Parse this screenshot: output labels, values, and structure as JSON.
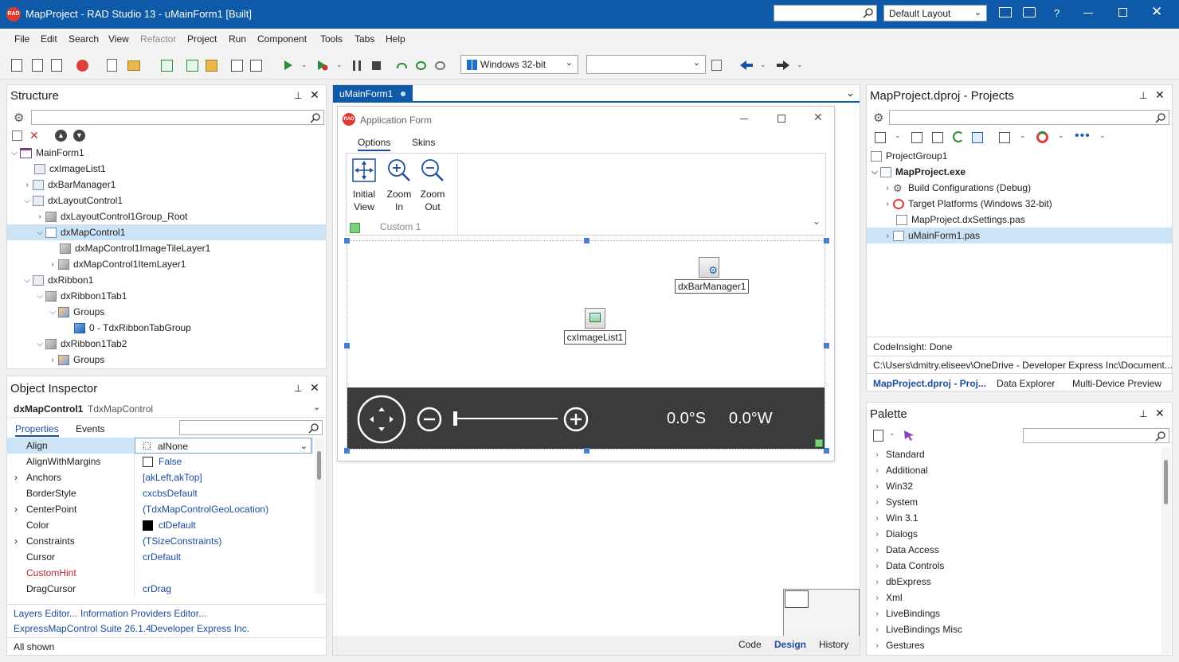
{
  "titlebar": {
    "title": "MapProject - RAD Studio 13 - uMainForm1 [Built]",
    "layout": "Default Layout",
    "help": "?"
  },
  "menu": [
    "File",
    "Edit",
    "Search",
    "View",
    "Refactor",
    "Project",
    "Run",
    "Component",
    "Tools",
    "Tabs",
    "Help"
  ],
  "toolbar": {
    "platform": "Windows 32-bit"
  },
  "structure": {
    "title": "Structure",
    "items": [
      {
        "label": "MainForm1"
      },
      {
        "label": "cxImageList1"
      },
      {
        "label": "dxBarManager1"
      },
      {
        "label": "dxLayoutControl1"
      },
      {
        "label": "dxLayoutControl1Group_Root"
      },
      {
        "label": "dxMapControl1"
      },
      {
        "label": "dxMapControl1ImageTileLayer1"
      },
      {
        "label": "dxMapControl1ItemLayer1"
      },
      {
        "label": "dxRibbon1"
      },
      {
        "label": "dxRibbon1Tab1"
      },
      {
        "label": "Groups"
      },
      {
        "label": "0 - TdxRibbonTabGroup"
      },
      {
        "label": "dxRibbon1Tab2"
      },
      {
        "label": "Groups"
      }
    ]
  },
  "inspector": {
    "title": "Object Inspector",
    "object_name": "dxMapControl1",
    "object_type": "TdxMapControl",
    "tab_properties": "Properties",
    "tab_events": "Events",
    "rows": [
      {
        "name": "Align",
        "value": "alNone"
      },
      {
        "name": "AlignWithMargins",
        "value": "False"
      },
      {
        "name": "Anchors",
        "value": "[akLeft,akTop]"
      },
      {
        "name": "BorderStyle",
        "value": "cxcbsDefault"
      },
      {
        "name": "CenterPoint",
        "value": "(TdxMapControlGeoLocation)"
      },
      {
        "name": "Color",
        "value": "clDefault"
      },
      {
        "name": "Constraints",
        "value": "(TSizeConstraints)"
      },
      {
        "name": "Cursor",
        "value": "crDefault"
      },
      {
        "name": "CustomHint",
        "value": ""
      },
      {
        "name": "DragCursor",
        "value": "crDrag"
      }
    ],
    "links": {
      "layers": "Layers Editor...",
      "providers": "Information Providers Editor...",
      "suite": "ExpressMapControl Suite 26.1.4",
      "vendor": "Developer Express Inc."
    },
    "status": "All shown"
  },
  "designer": {
    "tab": "uMainForm1",
    "form_title": "Application Form",
    "ribbon_tabs": [
      "Options",
      "Skins"
    ],
    "buttons": [
      {
        "line1": "Initial",
        "line2": "View"
      },
      {
        "line1": "Zoom",
        "line2": "In"
      },
      {
        "line1": "Zoom",
        "line2": "Out"
      }
    ],
    "group_caption": "Custom 1",
    "component_bar": "dxBarManager1",
    "component_img": "cxImageList1",
    "lat": "0.0°S",
    "lon": "0.0°W",
    "bottom_tabs": [
      "Code",
      "Design",
      "History"
    ]
  },
  "projects": {
    "title": "MapProject.dproj - Projects",
    "items": [
      {
        "label": "ProjectGroup1"
      },
      {
        "label": "MapProject.exe"
      },
      {
        "label": "Build Configurations (Debug)"
      },
      {
        "label": "Target Platforms (Windows 32-bit)"
      },
      {
        "label": "MapProject.dxSettings.pas"
      },
      {
        "label": "uMainForm1.pas"
      }
    ],
    "codeinsight": "CodeInsight: Done",
    "path": "C:\\Users\\dmitry.eliseev\\OneDrive - Developer Express Inc\\Document...",
    "tabs": [
      "MapProject.dproj - Proj...",
      "Data Explorer",
      "Multi-Device Preview"
    ]
  },
  "palette": {
    "title": "Palette",
    "items": [
      "Standard",
      "Additional",
      "Win32",
      "System",
      "Win 3.1",
      "Dialogs",
      "Data Access",
      "Data Controls",
      "dbExpress",
      "Xml",
      "LiveBindings",
      "LiveBindings Misc",
      "Gestures"
    ]
  }
}
